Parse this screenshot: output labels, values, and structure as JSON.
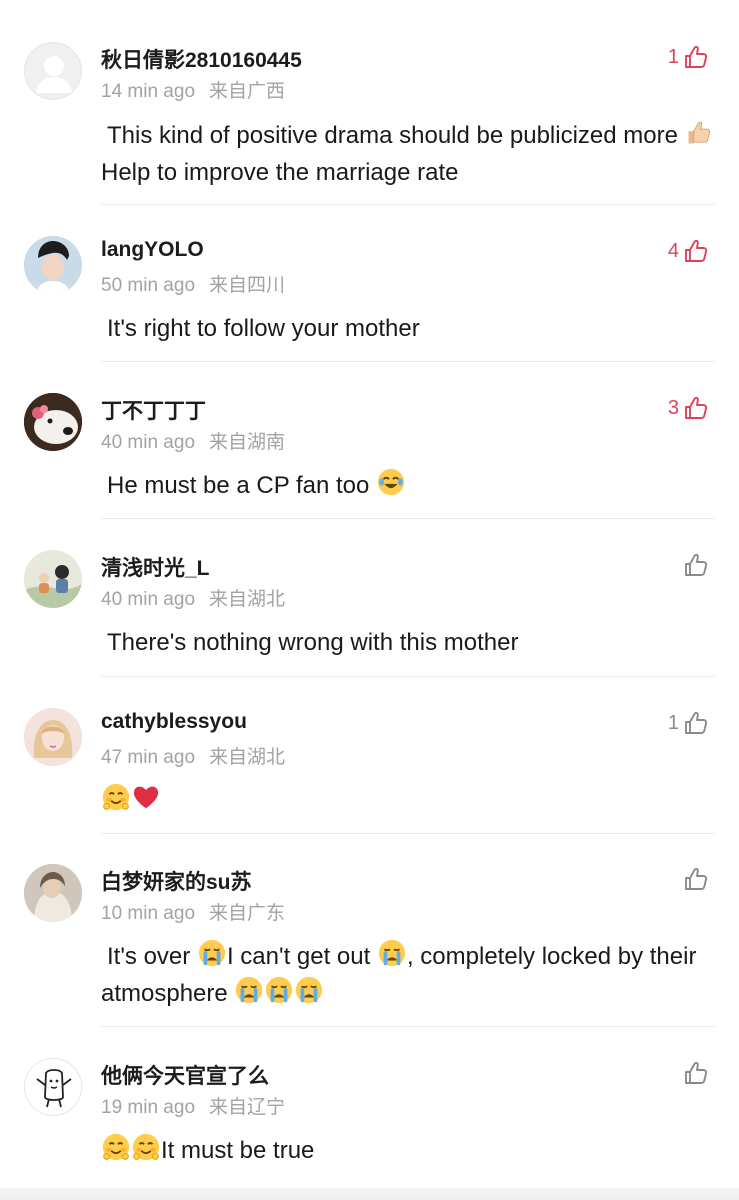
{
  "comments": [
    {
      "username": "秋日倩影2810160445",
      "time": "14 min ago",
      "location": "来自广西",
      "likes": "1",
      "liked": true,
      "text_a": "This kind of positive drama should be publicized more ",
      "text_b": "Help to improve the marriage rate",
      "avatar": "default-avatar",
      "emoji": [
        "thumbs-up-emoji"
      ]
    },
    {
      "username": "langYOLO",
      "time": "50 min ago",
      "location": "来自四川",
      "likes": "4",
      "liked": true,
      "text_a": "It's right to follow your mother",
      "avatar": "user-photo"
    },
    {
      "username": "丁不丁丁丁",
      "time": "40 min ago",
      "location": "来自湖南",
      "likes": "3",
      "liked": true,
      "text_a": "He must be a CP fan too ",
      "avatar": "dog-photo",
      "emoji": [
        "laughing-crying-emoji"
      ]
    },
    {
      "username": "清浅时光_L",
      "time": "40 min ago",
      "location": "来自湖北",
      "likes": "",
      "liked": false,
      "text_a": "There's nothing wrong with this mother",
      "avatar": "illustration"
    },
    {
      "username": "cathyblessyou",
      "time": "47 min ago",
      "location": "来自湖北",
      "likes": "1",
      "liked": false,
      "text_a": "",
      "avatar": "anime-girl",
      "emoji": [
        "blushing-emoji",
        "heart-emoji"
      ]
    },
    {
      "username": "白梦妍家的su苏",
      "time": "10 min ago",
      "location": "来自广东",
      "likes": "",
      "liked": false,
      "text_a": "It's over ",
      "text_b": "I can't get out ",
      "text_c": ", completely locked by their atmosphere ",
      "avatar": "user-photo-2",
      "emoji": [
        "crying-emoji"
      ]
    },
    {
      "username": "他俩今天官宣了么",
      "time": "19 min ago",
      "location": "来自辽宁",
      "likes": "",
      "liked": false,
      "text_a": "It must be true",
      "avatar": "cartoon-doodle",
      "emoji": [
        "blushing-emoji"
      ]
    }
  ],
  "colors": {
    "like_active": "#e0405a",
    "like_inactive": "#8a8a8a",
    "meta": "#a3a3a3",
    "divider": "#ececec"
  }
}
